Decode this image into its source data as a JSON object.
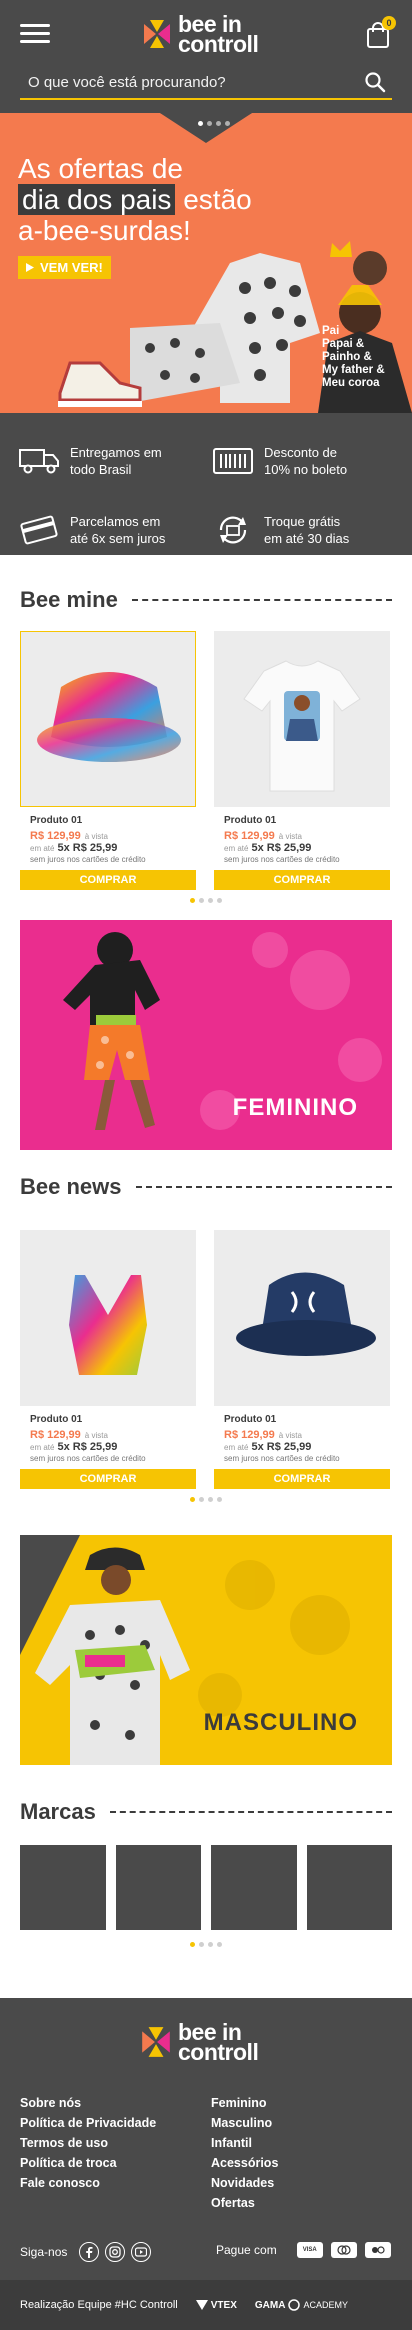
{
  "header": {
    "logo_line1": "bee in",
    "logo_line2": "controll",
    "cart_count": "0",
    "search_placeholder": "O que você está procurando?"
  },
  "hero": {
    "title_line1": "As ofertas de",
    "title_highlight": "dia dos pais",
    "title_after_highlight": " estão",
    "title_line3": "a-bee-surdas!",
    "cta": "VEM VER!",
    "shirt_text": "Pai\nPapai &\nPainho &\nMy father &\nMeu coroa",
    "slide_count": 4,
    "active_slide": 1
  },
  "features": [
    {
      "icon": "truck-icon",
      "text_line1": "Entregamos em",
      "text_line2": "todo Brasil"
    },
    {
      "icon": "barcode-icon",
      "text_line1": "Desconto de",
      "text_line2": "10% no boleto"
    },
    {
      "icon": "credit-card-icon",
      "text_line1": "Parcelamos em",
      "text_line2": "até 6x sem juros"
    },
    {
      "icon": "return-icon",
      "text_line1": "Troque grátis",
      "text_line2": "em até 30 dias"
    }
  ],
  "bee_mine": {
    "title": "Bee mine",
    "products": [
      {
        "name": "Produto 01",
        "price": "R$ 129,99",
        "price_note": "à vista",
        "inst_prefix": "em até",
        "installment": "5x R$ 25,99",
        "note": "sem juros nos cartões de crédito",
        "buy": "COMPRAR",
        "image": "tie-dye bucket hat"
      },
      {
        "name": "Produto 01",
        "price": "R$ 129,99",
        "price_note": "à vista",
        "inst_prefix": "em até",
        "installment": "5x R$ 25,99",
        "note": "sem juros nos cartões de crédito",
        "buy": "COMPRAR",
        "image": "white t-shirt with print"
      }
    ]
  },
  "banner_feminino": {
    "label": "FEMININO",
    "color": "#ea2d8e"
  },
  "bee_news": {
    "title": "Bee news",
    "products": [
      {
        "name": "Produto 01",
        "price": "R$ 129,99",
        "price_note": "à vista",
        "inst_prefix": "em até",
        "installment": "5x R$ 25,99",
        "note": "sem juros nos cartões de crédito",
        "buy": "COMPRAR",
        "image": "tie-dye sports bra"
      },
      {
        "name": "Produto 01",
        "price": "R$ 129,99",
        "price_note": "à vista",
        "inst_prefix": "em até",
        "installment": "5x R$ 25,99",
        "note": "sem juros nos cartões de crédito",
        "buy": "COMPRAR",
        "image": "navy bucket hat"
      }
    ]
  },
  "banner_masculino": {
    "label": "MASCULINO",
    "color": "#f6c403"
  },
  "marcas": {
    "title": "Marcas",
    "count": 4
  },
  "footer": {
    "logo_line1": "bee in",
    "logo_line2": "controll",
    "col1": [
      "Sobre nós",
      "Política de Privacidade",
      "Termos de uso",
      "Política de troca",
      "Fale conosco"
    ],
    "col2": [
      "Feminino",
      "Masculino",
      "Infantil",
      "Acessórios",
      "Novidades",
      "Ofertas"
    ],
    "follow": "Siga-nos",
    "pay_with": "Pague com",
    "payments": [
      "VISA",
      "MC",
      "ELO"
    ],
    "credits": "Realização Equipe #HC Controll",
    "partner1": "VTEX",
    "partner2_a": "GAMA",
    "partner2_b": "ACADEMY"
  },
  "colors": {
    "dark": "#4a4a4a",
    "yellow": "#f6c403",
    "orange": "#f47a4e",
    "pink": "#ea2d8e"
  }
}
